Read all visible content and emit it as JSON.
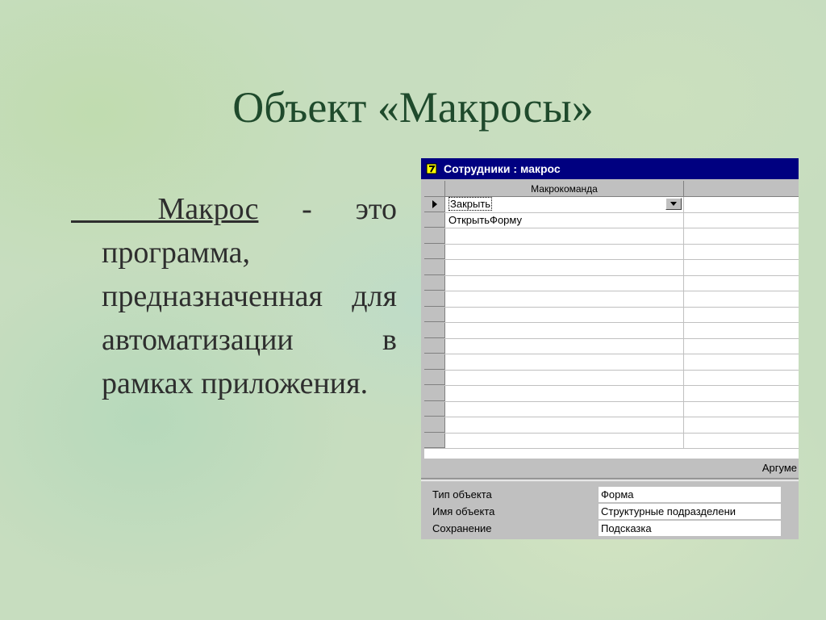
{
  "slide": {
    "title": "Объект «Макросы»",
    "body": {
      "lead": "  ",
      "term": "Макрос",
      "text": " - это программа, предназначенная для автоматизации в рамках приложения."
    }
  },
  "window": {
    "title": "Сотрудники : макрос",
    "icon": "macro-icon",
    "column_header": "Макрокоманда",
    "rows": [
      {
        "action": "Закрыть"
      },
      {
        "action": "ОткрытьФорму"
      },
      {
        "action": ""
      },
      {
        "action": ""
      },
      {
        "action": ""
      },
      {
        "action": ""
      },
      {
        "action": ""
      },
      {
        "action": ""
      },
      {
        "action": ""
      },
      {
        "action": ""
      },
      {
        "action": ""
      },
      {
        "action": ""
      },
      {
        "action": ""
      },
      {
        "action": ""
      },
      {
        "action": ""
      },
      {
        "action": ""
      }
    ],
    "arguments_label": "Аргуме",
    "properties": [
      {
        "label": "Тип объекта",
        "value": "Форма"
      },
      {
        "label": "Имя объекта",
        "value": "Структурные подразделени"
      },
      {
        "label": "Сохранение",
        "value": "Подсказка"
      }
    ]
  },
  "colors": {
    "title": "#1f4a2c",
    "titlebar": "#000080",
    "window_face": "#c0c0c0"
  }
}
